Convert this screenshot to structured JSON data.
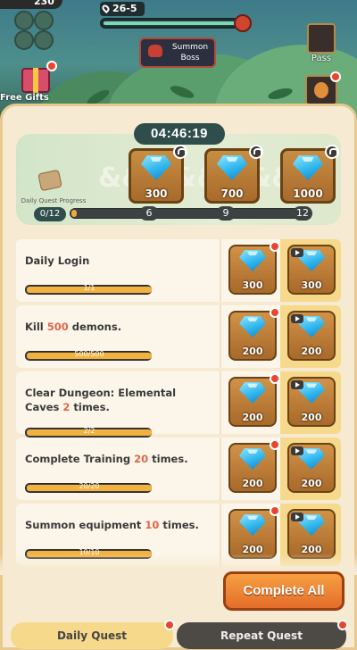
{
  "hud": {
    "top_value": "230",
    "stage": "26-5",
    "stage_progress": 0.95,
    "summon_boss": "Summon Boss",
    "free_gifts": "Free Gifts",
    "pass": "Pass"
  },
  "timer": "04:46:19",
  "daily_progress": {
    "label": "Daily Quest Progress",
    "count": "0/12",
    "fraction": 0,
    "milestones": [
      {
        "threshold": "6",
        "amount": "300"
      },
      {
        "threshold": "9",
        "amount": "700"
      },
      {
        "threshold": "12",
        "amount": "1000"
      }
    ]
  },
  "quests": [
    {
      "title_before": "Daily Login",
      "highlight": "",
      "title_after": "",
      "progress_text": "1/1",
      "progress": 1,
      "reward": "300",
      "ad_reward": "300"
    },
    {
      "title_before": "Kill ",
      "highlight": "500",
      "title_after": " demons.",
      "progress_text": "500/500",
      "progress": 1,
      "reward": "200",
      "ad_reward": "200"
    },
    {
      "title_before": "Clear Dungeon: Elemental Caves ",
      "highlight": "2",
      "title_after": " times.",
      "progress_text": "2/2",
      "progress": 1,
      "reward": "200",
      "ad_reward": "200"
    },
    {
      "title_before": "Complete Training ",
      "highlight": "20",
      "title_after": " times.",
      "progress_text": "20/20",
      "progress": 1,
      "reward": "200",
      "ad_reward": "200"
    },
    {
      "title_before": "Summon equipment ",
      "highlight": "10",
      "title_after": " times.",
      "progress_text": "10/10",
      "progress": 1,
      "reward": "200",
      "ad_reward": "200"
    }
  ],
  "complete_all": "Complete All",
  "tabs": {
    "daily": "Daily Quest",
    "repeat": "Repeat Quest"
  },
  "colors": {
    "accent_orange": "#e46d2a",
    "highlight": "#e3654b",
    "gem_blue": "#2db4ec",
    "progress_fill": "#f3b23e"
  }
}
